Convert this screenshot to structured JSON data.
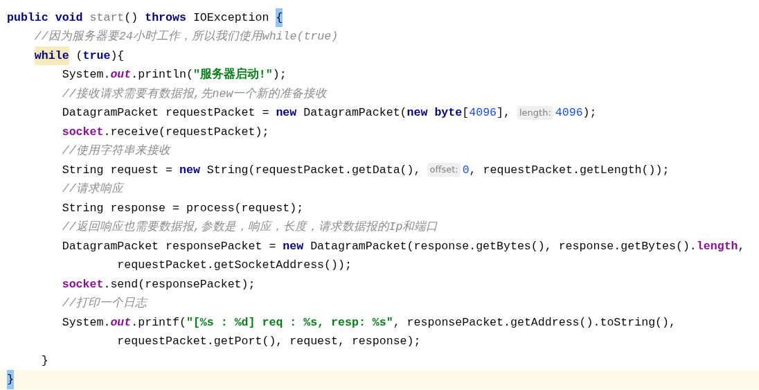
{
  "lines": [
    {
      "current": false,
      "tokens": [
        {
          "t": "public",
          "kind": "kw"
        },
        {
          "t": " void",
          "kind": "kw"
        },
        {
          "t": " start",
          "kind": "unused"
        },
        {
          "t": "() ",
          "kind": "plain"
        },
        {
          "t": "throws",
          "kind": "kw"
        },
        {
          "t": " IOException ",
          "kind": "plain"
        },
        {
          "t": "{",
          "kind": "plain",
          "matched": true
        }
      ]
    },
    {
      "current": false,
      "tokens": [
        {
          "t": "    //因为服务器要24小时工作，所以我们使用while(true)",
          "kind": "comment"
        }
      ]
    },
    {
      "current": false,
      "tokens": [
        {
          "t": "    while",
          "kind": "kw",
          "marked": true
        },
        {
          "t": " (",
          "kind": "plain"
        },
        {
          "t": "true",
          "kind": "kw"
        },
        {
          "t": "){",
          "kind": "plain"
        }
      ]
    },
    {
      "current": false,
      "tokens": [
        {
          "t": "        System.",
          "kind": "plain"
        },
        {
          "t": "out",
          "kind": "static"
        },
        {
          "t": ".println(",
          "kind": "plain"
        },
        {
          "t": "\"服务器启动!\"",
          "kind": "string"
        },
        {
          "t": ");",
          "kind": "plain"
        }
      ]
    },
    {
      "current": false,
      "tokens": [
        {
          "t": "        //接收请求需要有数据报,先new一个新的准备接收",
          "kind": "comment"
        }
      ]
    },
    {
      "current": false,
      "tokens": [
        {
          "t": "        DatagramPacket requestPacket = ",
          "kind": "plain"
        },
        {
          "t": "new",
          "kind": "kw"
        },
        {
          "t": " DatagramPacket(",
          "kind": "plain"
        },
        {
          "t": "new",
          "kind": "kw"
        },
        {
          "t": " byte",
          "kind": "kw"
        },
        {
          "t": "[",
          "kind": "plain"
        },
        {
          "t": "4096",
          "kind": "num"
        },
        {
          "t": "], ",
          "kind": "plain"
        },
        {
          "t": "length:",
          "kind": "hint"
        },
        {
          "t": "4096",
          "kind": "num"
        },
        {
          "t": ");",
          "kind": "plain"
        }
      ]
    },
    {
      "current": false,
      "tokens": [
        {
          "t": "        socket",
          "kind": "field"
        },
        {
          "t": ".receive(requestPacket);",
          "kind": "plain"
        }
      ]
    },
    {
      "current": false,
      "tokens": [
        {
          "t": "        //使用字符串来接收",
          "kind": "comment"
        }
      ]
    },
    {
      "current": false,
      "tokens": [
        {
          "t": "        String request = ",
          "kind": "plain"
        },
        {
          "t": "new",
          "kind": "kw"
        },
        {
          "t": " String(requestPacket.getData(), ",
          "kind": "plain"
        },
        {
          "t": "offset:",
          "kind": "hint"
        },
        {
          "t": "0",
          "kind": "num"
        },
        {
          "t": ", requestPacket.getLength());",
          "kind": "plain"
        }
      ]
    },
    {
      "current": false,
      "tokens": [
        {
          "t": "        //请求响应",
          "kind": "comment"
        }
      ]
    },
    {
      "current": false,
      "tokens": [
        {
          "t": "        String response = process(request);",
          "kind": "plain"
        }
      ]
    },
    {
      "current": false,
      "tokens": [
        {
          "t": "        //返回响应也需要数据报,参数是，响应，长度，请求数据报的Ip和端口",
          "kind": "comment"
        }
      ]
    },
    {
      "current": false,
      "tokens": [
        {
          "t": "        DatagramPacket responsePacket = ",
          "kind": "plain"
        },
        {
          "t": "new",
          "kind": "kw"
        },
        {
          "t": " DatagramPacket(response.getBytes(), response.getBytes().",
          "kind": "plain"
        },
        {
          "t": "length",
          "kind": "field"
        },
        {
          "t": ",",
          "kind": "plain"
        }
      ]
    },
    {
      "current": false,
      "tokens": [
        {
          "t": "                requestPacket.getSocketAddress());",
          "kind": "plain"
        }
      ]
    },
    {
      "current": false,
      "tokens": [
        {
          "t": "        socket",
          "kind": "field"
        },
        {
          "t": ".send(responsePacket);",
          "kind": "plain"
        }
      ]
    },
    {
      "current": false,
      "tokens": [
        {
          "t": "        //打印一个日志",
          "kind": "comment"
        }
      ]
    },
    {
      "current": false,
      "tokens": [
        {
          "t": "        System.",
          "kind": "plain"
        },
        {
          "t": "out",
          "kind": "static"
        },
        {
          "t": ".printf(",
          "kind": "plain"
        },
        {
          "t": "\"[%s : %d] req : %s, resp: %s\"",
          "kind": "string"
        },
        {
          "t": ", responsePacket.getAddress().toString(),",
          "kind": "plain"
        }
      ]
    },
    {
      "current": false,
      "tokens": [
        {
          "t": "                requestPacket.getPort(), request, response);",
          "kind": "plain"
        }
      ]
    },
    {
      "current": false,
      "tokens": [
        {
          "t": "     }",
          "kind": "plain"
        }
      ]
    },
    {
      "current": true,
      "tokens": [
        {
          "t": "}",
          "kind": "plain",
          "matched": true
        }
      ]
    }
  ]
}
